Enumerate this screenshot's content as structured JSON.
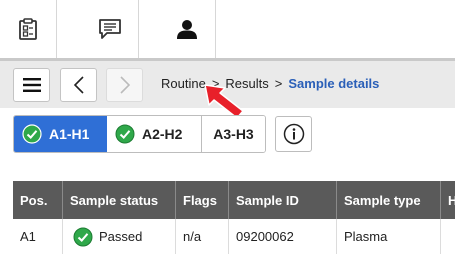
{
  "topbar": {
    "icons": [
      "clipboard-icon",
      "message-icon",
      "user-icon"
    ]
  },
  "nav": {
    "icons": [
      "menu-icon",
      "back-icon",
      "forward-icon"
    ],
    "breadcrumb": [
      {
        "label": "Routine"
      },
      {
        "label": "Results"
      },
      {
        "label": "Sample details"
      }
    ],
    "separator": ">"
  },
  "segments": [
    {
      "label": "A1-H1",
      "selected": true,
      "checked": true
    },
    {
      "label": "A2-H2",
      "selected": false,
      "checked": true
    },
    {
      "label": "A3-H3",
      "selected": false,
      "checked": false
    }
  ],
  "info_icon": "info-icon",
  "table": {
    "columns": [
      "Pos.",
      "Sample status",
      "Flags",
      "Sample ID",
      "Sample type",
      "H"
    ],
    "rows": [
      {
        "pos": "A1",
        "status": "Passed",
        "flags": "n/a",
        "sample_id": "09200062",
        "sample_type": "Plasma"
      }
    ]
  },
  "colors": {
    "accent": "#2f6fd6",
    "check_green": "#2fa84a",
    "header_bg": "#5a5a5a",
    "breadcrumb_current": "#2a5fb8",
    "cursor": "#e8202a"
  }
}
